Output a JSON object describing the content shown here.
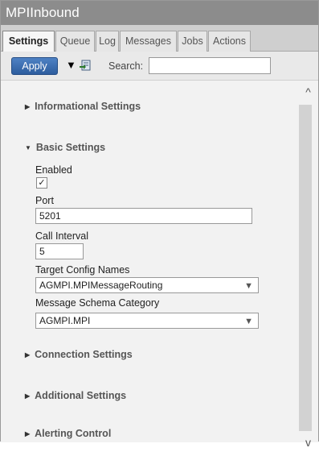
{
  "window": {
    "title": "MPIInbound"
  },
  "tabs": [
    {
      "label": "Settings",
      "active": true
    },
    {
      "label": "Queue"
    },
    {
      "label": "Log"
    },
    {
      "label": "Messages"
    },
    {
      "label": "Jobs"
    },
    {
      "label": "Actions"
    }
  ],
  "toolbar": {
    "apply_label": "Apply",
    "filter_icon": "caret-down-icon",
    "export_icon": "export-icon",
    "search_label": "Search:",
    "search_value": ""
  },
  "sections": {
    "informational": {
      "label": "Informational Settings",
      "expanded": false
    },
    "basic": {
      "label": "Basic Settings",
      "expanded": true
    },
    "connection": {
      "label": "Connection Settings",
      "expanded": false
    },
    "additional": {
      "label": "Additional Settings",
      "expanded": false
    },
    "alerting": {
      "label": "Alerting Control",
      "expanded": false
    }
  },
  "basic_settings": {
    "enabled": {
      "label": "Enabled",
      "checked": true
    },
    "port": {
      "label": "Port",
      "value": "5201"
    },
    "call_interval": {
      "label": "Call Interval",
      "value": "5"
    },
    "target_config": {
      "label": "Target Config Names",
      "value": "AGMPI.MPIMessageRouting"
    },
    "schema_category": {
      "label": "Message Schema Category",
      "value": "AGMPI.MPI"
    }
  },
  "colors": {
    "title_bar": "#8c8c8c",
    "apply_button": "#3b6cb0",
    "panel_bg": "#f2f2f2"
  }
}
